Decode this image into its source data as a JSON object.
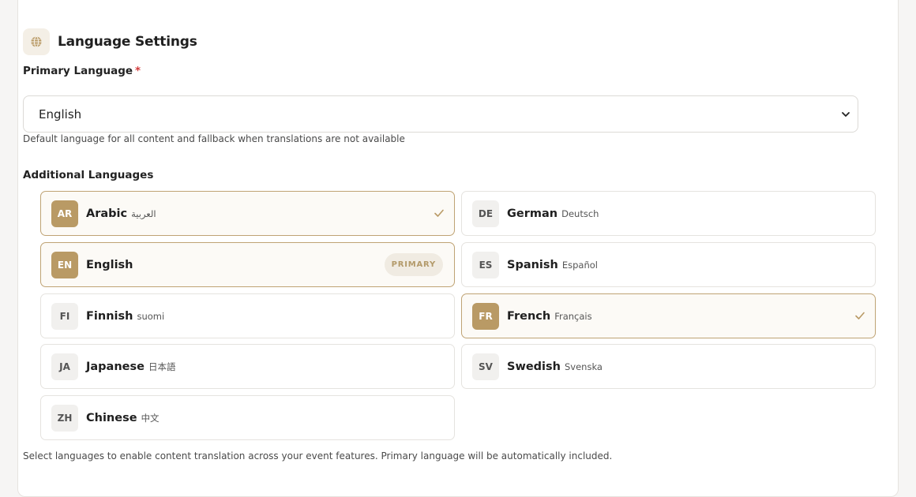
{
  "section": {
    "title": "Language Settings",
    "icon": "globe-icon"
  },
  "primary": {
    "label": "Primary Language",
    "required_mark": "*",
    "value": "English",
    "help": "Default language for all content and fallback when translations are not available"
  },
  "additional": {
    "label": "Additional Languages",
    "help": "Select languages to enable content translation across your event features. Primary language will be automatically included.",
    "primary_tag": "PRIMARY",
    "languages": [
      {
        "code": "AR",
        "name": "Arabic",
        "native": "العربية",
        "selected": true
      },
      {
        "code": "DE",
        "name": "German",
        "native": "Deutsch",
        "selected": false
      },
      {
        "code": "EN",
        "name": "English",
        "native": "",
        "selected": true,
        "primary": true
      },
      {
        "code": "ES",
        "name": "Spanish",
        "native": "Español",
        "selected": false
      },
      {
        "code": "FI",
        "name": "Finnish",
        "native": "suomi",
        "selected": false
      },
      {
        "code": "FR",
        "name": "French",
        "native": "Français",
        "selected": true
      },
      {
        "code": "JA",
        "name": "Japanese",
        "native": "日本語",
        "selected": false
      },
      {
        "code": "SV",
        "name": "Swedish",
        "native": "Svenska",
        "selected": false
      },
      {
        "code": "ZH",
        "name": "Chinese",
        "native": "中文",
        "selected": false
      }
    ]
  },
  "colors": {
    "accent": "#b99a65",
    "accent_border": "#bfa374",
    "required": "#d23b3b"
  }
}
